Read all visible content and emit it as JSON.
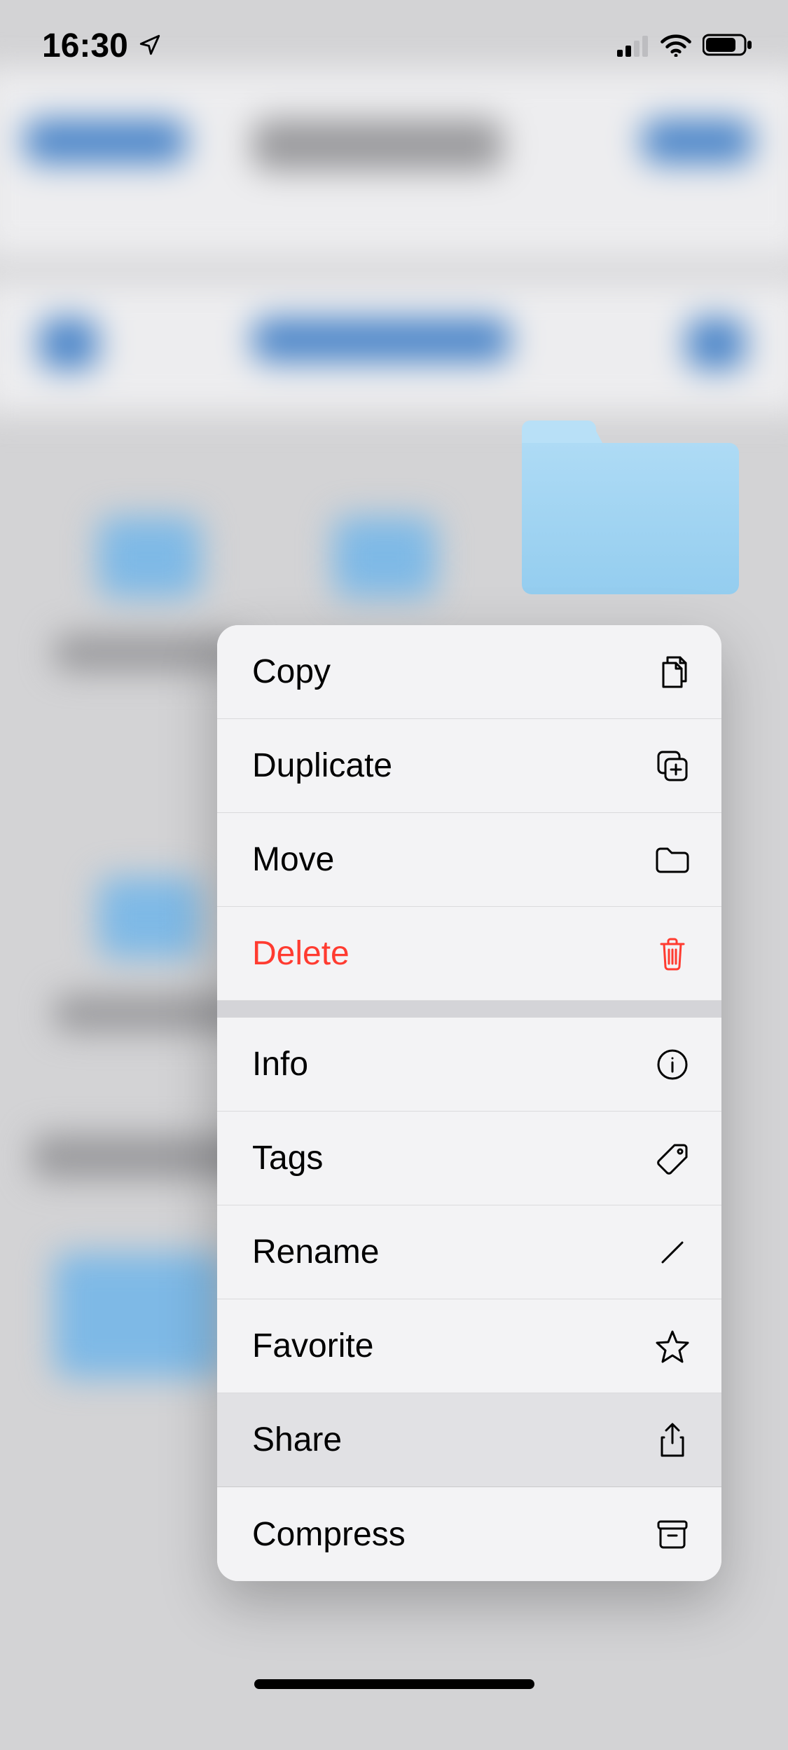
{
  "status_bar": {
    "time": "16:30"
  },
  "menu": {
    "items": [
      {
        "label": "Copy",
        "icon": "copy-icon",
        "destructive": false
      },
      {
        "label": "Duplicate",
        "icon": "duplicate-icon",
        "destructive": false
      },
      {
        "label": "Move",
        "icon": "folder-icon",
        "destructive": false
      },
      {
        "label": "Delete",
        "icon": "trash-icon",
        "destructive": true
      }
    ],
    "items2": [
      {
        "label": "Info",
        "icon": "info-icon"
      },
      {
        "label": "Tags",
        "icon": "tag-icon"
      },
      {
        "label": "Rename",
        "icon": "pencil-icon"
      },
      {
        "label": "Favorite",
        "icon": "star-icon"
      },
      {
        "label": "Share",
        "icon": "share-icon",
        "selected": true
      },
      {
        "label": "Compress",
        "icon": "archive-icon"
      }
    ]
  },
  "colors": {
    "destructive": "#ff3b30",
    "folder_light": "#b8e0f7",
    "folder_dark": "#94cdef"
  }
}
